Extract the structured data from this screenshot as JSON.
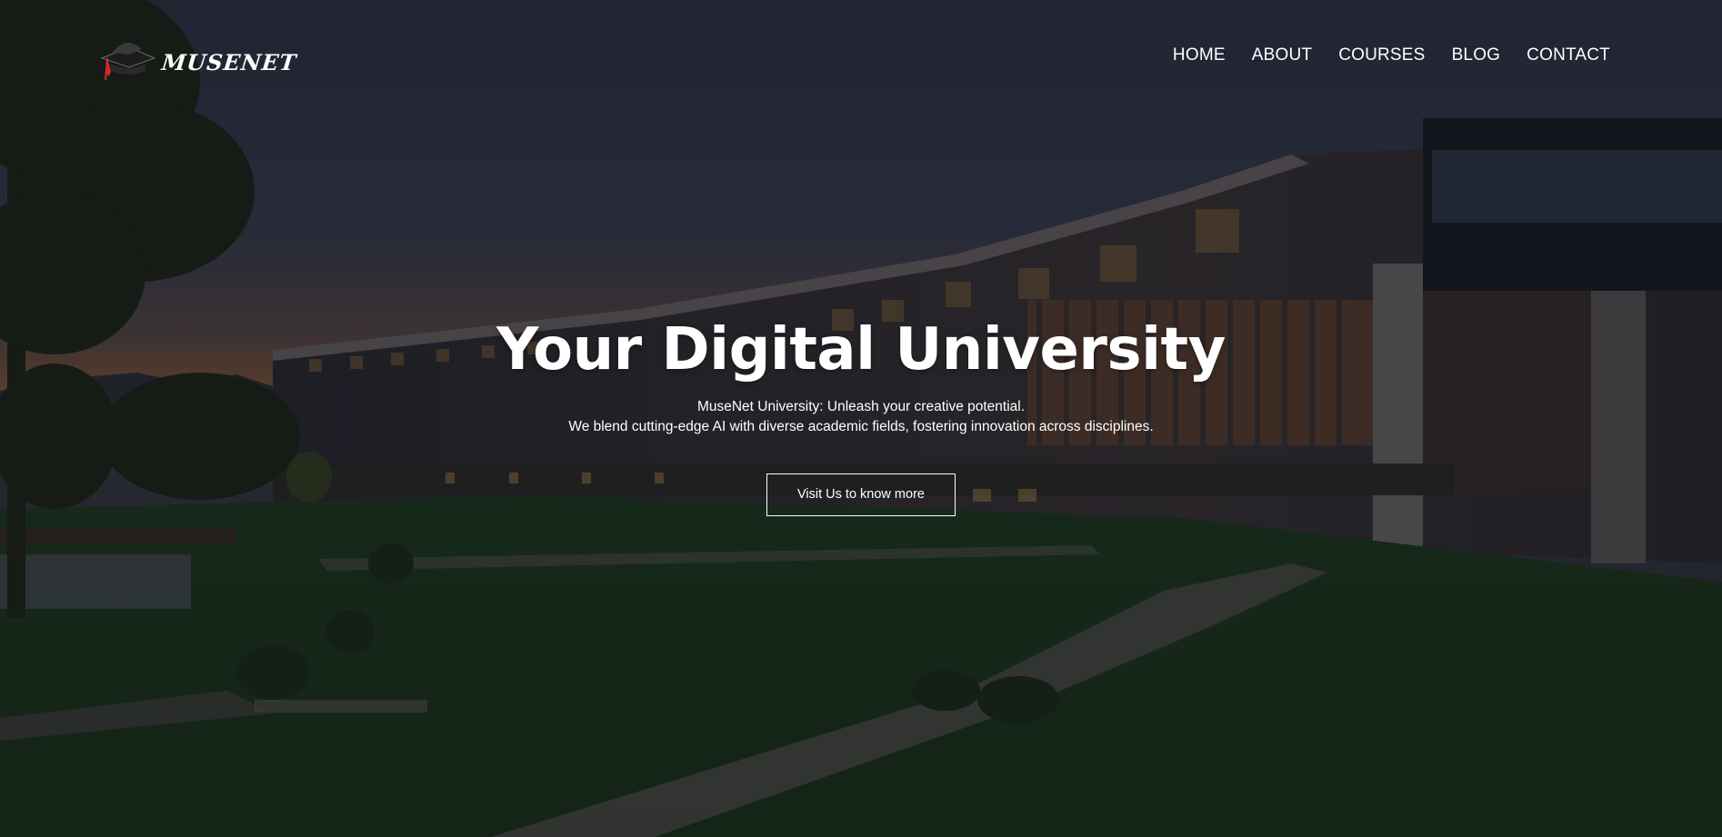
{
  "brand": {
    "name": "MUSENET",
    "logo_icon": "graduation-cap-icon"
  },
  "nav": {
    "items": [
      {
        "label": "HOME"
      },
      {
        "label": "ABOUT"
      },
      {
        "label": "COURSES"
      },
      {
        "label": "BLOG"
      },
      {
        "label": "CONTACT"
      }
    ]
  },
  "hero": {
    "title": "Your Digital University",
    "subtitle_line1": "MuseNet University: Unleash your creative potential.",
    "subtitle_line2": "We blend cutting-edge AI with diverse academic fields, fostering innovation across disciplines.",
    "cta_label": "Visit Us to know more"
  },
  "colors": {
    "text": "#ffffff",
    "overlay": "#0a0c16",
    "accent_red": "#d42a2a"
  }
}
